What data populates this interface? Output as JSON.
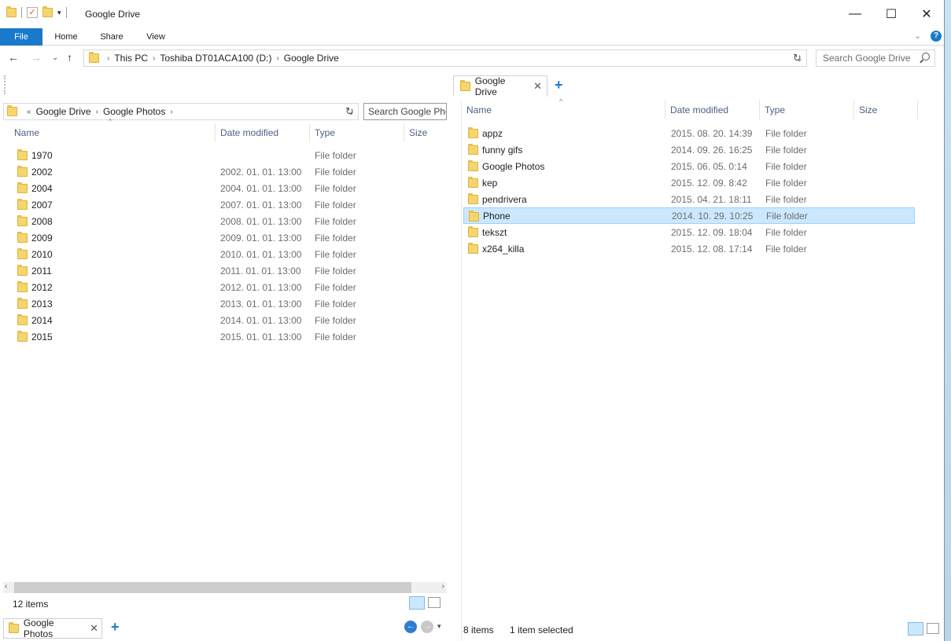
{
  "window": {
    "title": "Google Drive"
  },
  "ribbon": {
    "tabs": [
      "File",
      "Home",
      "Share",
      "View"
    ]
  },
  "nav": {
    "breadcrumb": [
      "This PC",
      "Toshiba DT01ACA100 (D:)",
      "Google Drive"
    ],
    "search_placeholder": "Search Google Drive"
  },
  "right_pane": {
    "tab_label": "Google Drive",
    "columns": [
      "Name",
      "Date modified",
      "Type",
      "Size"
    ],
    "rows": [
      {
        "name": "appz",
        "date": "2015. 08. 20. 14:39",
        "type": "File folder",
        "selected": false
      },
      {
        "name": "funny gifs",
        "date": "2014. 09. 26. 16:25",
        "type": "File folder",
        "selected": false
      },
      {
        "name": "Google Photos",
        "date": "2015. 06. 05. 0:14",
        "type": "File folder",
        "selected": false
      },
      {
        "name": "kep",
        "date": "2015. 12. 09. 8:42",
        "type": "File folder",
        "selected": false
      },
      {
        "name": "pendrivera",
        "date": "2015. 04. 21. 18:11",
        "type": "File folder",
        "selected": false
      },
      {
        "name": "Phone",
        "date": "2014. 10. 29. 10:25",
        "type": "File folder",
        "selected": true
      },
      {
        "name": "tekszt",
        "date": "2015. 12. 09. 18:04",
        "type": "File folder",
        "selected": false
      },
      {
        "name": "x264_killa",
        "date": "2015. 12. 08. 17:14",
        "type": "File folder",
        "selected": false
      }
    ],
    "status_items": "8 items",
    "status_selected": "1 item selected"
  },
  "left_pane": {
    "breadcrumb_prefix": "«",
    "breadcrumb": [
      "Google Drive",
      "Google Photos"
    ],
    "search_placeholder": "Search Google Pho",
    "columns": [
      "Name",
      "Date modified",
      "Type",
      "Size"
    ],
    "rows": [
      {
        "name": "1970",
        "date": "",
        "type": "File folder"
      },
      {
        "name": "2002",
        "date": "2002. 01. 01. 13:00",
        "type": "File folder"
      },
      {
        "name": "2004",
        "date": "2004. 01. 01. 13:00",
        "type": "File folder"
      },
      {
        "name": "2007",
        "date": "2007. 01. 01. 13:00",
        "type": "File folder"
      },
      {
        "name": "2008",
        "date": "2008. 01. 01. 13:00",
        "type": "File folder"
      },
      {
        "name": "2009",
        "date": "2009. 01. 01. 13:00",
        "type": "File folder"
      },
      {
        "name": "2010",
        "date": "2010. 01. 01. 13:00",
        "type": "File folder"
      },
      {
        "name": "2011",
        "date": "2011. 01. 01. 13:00",
        "type": "File folder"
      },
      {
        "name": "2012",
        "date": "2012. 01. 01. 13:00",
        "type": "File folder"
      },
      {
        "name": "2013",
        "date": "2013. 01. 01. 13:00",
        "type": "File folder"
      },
      {
        "name": "2014",
        "date": "2014. 01. 01. 13:00",
        "type": "File folder"
      },
      {
        "name": "2015",
        "date": "2015. 01. 01. 13:00",
        "type": "File folder"
      }
    ],
    "status_items": "12 items",
    "tab_label": "Google Photos"
  },
  "colors": {
    "accent": "#1979ca",
    "selection": "#cce8ff",
    "header_text": "#4d6082"
  }
}
